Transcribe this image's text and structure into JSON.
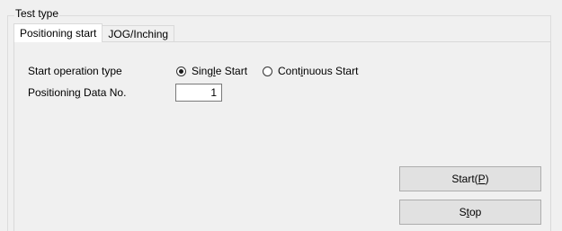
{
  "group": {
    "title": "Test type"
  },
  "tabs": [
    {
      "label": "Positioning start",
      "active": true
    },
    {
      "label": "JOG/Inching",
      "active": false
    }
  ],
  "start_operation": {
    "label": "Start operation type",
    "options": [
      {
        "pre": "Sing",
        "mnemonic": "l",
        "post": "e Start",
        "selected": true
      },
      {
        "pre": "Cont",
        "mnemonic": "i",
        "post": "nuous Start",
        "selected": false
      }
    ]
  },
  "positioning_data": {
    "label_pre": "Positionin",
    "label_mnemonic": "g",
    "label_post": " Data No.",
    "value": "1"
  },
  "buttons": {
    "start": {
      "pre": "Start(",
      "mnemonic": "P",
      "post": ")"
    },
    "stop": {
      "pre": "S",
      "mnemonic": "t",
      "post": "op"
    }
  }
}
